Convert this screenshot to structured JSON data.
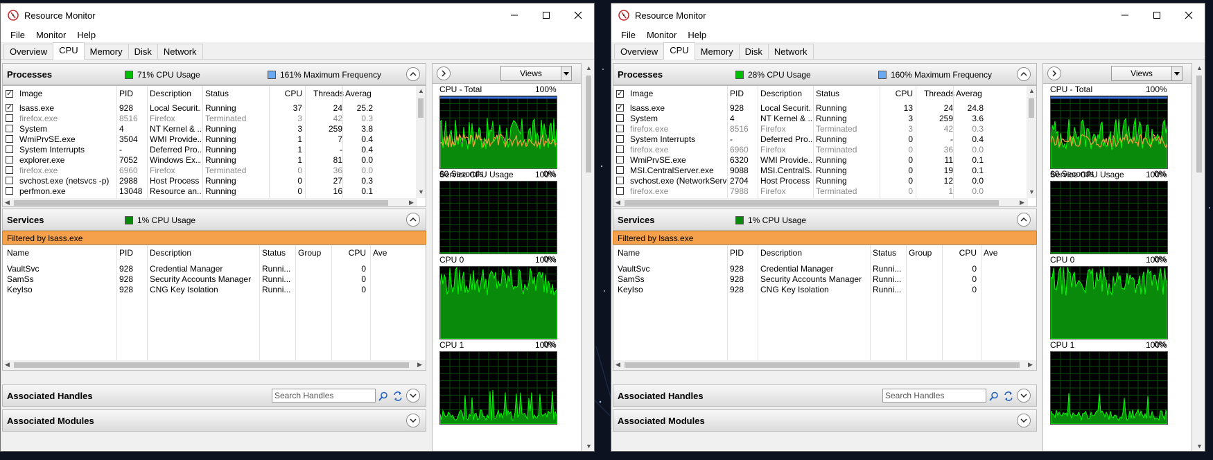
{
  "colors": {
    "cpu_usage": "#00c000",
    "max_freq": "#6aa9f1",
    "filter_bar": "#f5a04a",
    "graph_bg": "#000000",
    "graph_line": "#00ff00",
    "freq_line": "#f0a040"
  },
  "windows": [
    {
      "title": "Resource Monitor",
      "menu": [
        "File",
        "Monitor",
        "Help"
      ],
      "tabs": [
        "Overview",
        "CPU",
        "Memory",
        "Disk",
        "Network"
      ],
      "active_tab": "CPU",
      "processes": {
        "title": "Processes",
        "cpu_usage": "71% CPU Usage",
        "max_freq": "161% Maximum Frequency",
        "columns": [
          "Image",
          "PID",
          "Description",
          "Status",
          "CPU",
          "Threads",
          "Averag"
        ],
        "rows": [
          {
            "checked": true,
            "image": "lsass.exe",
            "pid": "928",
            "desc": "Local Securit...",
            "status": "Running",
            "cpu": "37",
            "threads": "24",
            "avg": "25.2",
            "terminated": false
          },
          {
            "checked": false,
            "image": "firefox.exe",
            "pid": "8516",
            "desc": "Firefox",
            "status": "Terminated",
            "cpu": "3",
            "threads": "42",
            "avg": "0.3",
            "terminated": true
          },
          {
            "checked": false,
            "image": "System",
            "pid": "4",
            "desc": "NT Kernel & ...",
            "status": "Running",
            "cpu": "3",
            "threads": "259",
            "avg": "3.8",
            "terminated": false
          },
          {
            "checked": false,
            "image": "WmiPrvSE.exe",
            "pid": "3504",
            "desc": "WMI Provide...",
            "status": "Running",
            "cpu": "1",
            "threads": "7",
            "avg": "0.4",
            "terminated": false
          },
          {
            "checked": false,
            "image": "System Interrupts",
            "pid": "-",
            "desc": "Deferred Pro...",
            "status": "Running",
            "cpu": "1",
            "threads": "-",
            "avg": "0.4",
            "terminated": false
          },
          {
            "checked": false,
            "image": "explorer.exe",
            "pid": "7052",
            "desc": "Windows Ex...",
            "status": "Running",
            "cpu": "1",
            "threads": "81",
            "avg": "0.0",
            "terminated": false
          },
          {
            "checked": false,
            "image": "firefox.exe",
            "pid": "6960",
            "desc": "Firefox",
            "status": "Terminated",
            "cpu": "0",
            "threads": "36",
            "avg": "0.0",
            "terminated": true
          },
          {
            "checked": false,
            "image": "svchost.exe (netsvcs -p)",
            "pid": "2988",
            "desc": "Host Process ...",
            "status": "Running",
            "cpu": "0",
            "threads": "27",
            "avg": "0.3",
            "terminated": false
          },
          {
            "checked": false,
            "image": "perfmon.exe",
            "pid": "13048",
            "desc": "Resource an...",
            "status": "Running",
            "cpu": "0",
            "threads": "16",
            "avg": "0.1",
            "terminated": false
          }
        ]
      },
      "services": {
        "title": "Services",
        "cpu_usage": "1% CPU Usage",
        "filter": "Filtered by lsass.exe",
        "columns": [
          "Name",
          "PID",
          "Description",
          "Status",
          "Group",
          "CPU",
          "Ave"
        ],
        "rows": [
          {
            "name": "VaultSvc",
            "pid": "928",
            "desc": "Credential Manager",
            "status": "Runni...",
            "group": "",
            "cpu": "0"
          },
          {
            "name": "SamSs",
            "pid": "928",
            "desc": "Security Accounts Manager",
            "status": "Runni...",
            "group": "",
            "cpu": "0"
          },
          {
            "name": "KeyIso",
            "pid": "928",
            "desc": "CNG Key Isolation",
            "status": "Runni...",
            "group": "",
            "cpu": "0"
          }
        ]
      },
      "handles": {
        "title": "Associated Handles",
        "search_placeholder": "Search Handles"
      },
      "modules": {
        "title": "Associated Modules"
      },
      "graphs": {
        "views": "Views",
        "items": [
          {
            "label": "CPU - Total",
            "max": "100%",
            "min": "0%",
            "footer": "60 Seconds"
          },
          {
            "label": "Service CPU Usage",
            "max": "100%",
            "min": "0%",
            "footer": ""
          },
          {
            "label": "CPU 0",
            "max": "100%",
            "min": "0%",
            "footer": ""
          },
          {
            "label": "CPU 1",
            "max": "100%",
            "min": "",
            "footer": ""
          }
        ]
      }
    },
    {
      "title": "Resource Monitor",
      "menu": [
        "File",
        "Monitor",
        "Help"
      ],
      "tabs": [
        "Overview",
        "CPU",
        "Memory",
        "Disk",
        "Network"
      ],
      "active_tab": "CPU",
      "processes": {
        "title": "Processes",
        "cpu_usage": "28% CPU Usage",
        "max_freq": "160% Maximum Frequency",
        "columns": [
          "Image",
          "PID",
          "Description",
          "Status",
          "CPU",
          "Threads",
          "Averag"
        ],
        "rows": [
          {
            "checked": true,
            "image": "lsass.exe",
            "pid": "928",
            "desc": "Local Securit...",
            "status": "Running",
            "cpu": "13",
            "threads": "24",
            "avg": "24.8",
            "terminated": false
          },
          {
            "checked": false,
            "image": "System",
            "pid": "4",
            "desc": "NT Kernel & ...",
            "status": "Running",
            "cpu": "3",
            "threads": "259",
            "avg": "3.6",
            "terminated": false
          },
          {
            "checked": false,
            "image": "firefox.exe",
            "pid": "8516",
            "desc": "Firefox",
            "status": "Terminated",
            "cpu": "3",
            "threads": "42",
            "avg": "0.3",
            "terminated": true
          },
          {
            "checked": false,
            "image": "System Interrupts",
            "pid": "-",
            "desc": "Deferred Pro...",
            "status": "Running",
            "cpu": "0",
            "threads": "-",
            "avg": "0.4",
            "terminated": false
          },
          {
            "checked": false,
            "image": "firefox.exe",
            "pid": "6960",
            "desc": "Firefox",
            "status": "Terminated",
            "cpu": "0",
            "threads": "36",
            "avg": "0.0",
            "terminated": true
          },
          {
            "checked": false,
            "image": "WmiPrvSE.exe",
            "pid": "6320",
            "desc": "WMI Provide...",
            "status": "Running",
            "cpu": "0",
            "threads": "11",
            "avg": "0.1",
            "terminated": false
          },
          {
            "checked": false,
            "image": "MSI.CentralServer.exe",
            "pid": "9088",
            "desc": "MSI.CentralS...",
            "status": "Running",
            "cpu": "0",
            "threads": "19",
            "avg": "0.1",
            "terminated": false
          },
          {
            "checked": false,
            "image": "svchost.exe (NetworkService...",
            "pid": "2704",
            "desc": "Host Process ...",
            "status": "Running",
            "cpu": "0",
            "threads": "12",
            "avg": "0.0",
            "terminated": false
          },
          {
            "checked": false,
            "image": "firefox.exe",
            "pid": "7988",
            "desc": "Firefox",
            "status": "Terminated",
            "cpu": "0",
            "threads": "1",
            "avg": "0.0",
            "terminated": true
          }
        ]
      },
      "services": {
        "title": "Services",
        "cpu_usage": "1% CPU Usage",
        "filter": "Filtered by lsass.exe",
        "columns": [
          "Name",
          "PID",
          "Description",
          "Status",
          "Group",
          "CPU",
          "Ave"
        ],
        "rows": [
          {
            "name": "VaultSvc",
            "pid": "928",
            "desc": "Credential Manager",
            "status": "Runni...",
            "group": "",
            "cpu": "0"
          },
          {
            "name": "SamSs",
            "pid": "928",
            "desc": "Security Accounts Manager",
            "status": "Runni...",
            "group": "",
            "cpu": "0"
          },
          {
            "name": "KeyIso",
            "pid": "928",
            "desc": "CNG Key Isolation",
            "status": "Runni...",
            "group": "",
            "cpu": "0"
          }
        ]
      },
      "handles": {
        "title": "Associated Handles",
        "search_placeholder": "Search Handles"
      },
      "modules": {
        "title": "Associated Modules"
      },
      "graphs": {
        "views": "Views",
        "items": [
          {
            "label": "CPU - Total",
            "max": "100%",
            "min": "0%",
            "footer": "60 Seconds"
          },
          {
            "label": "Service CPU Usage",
            "max": "100%",
            "min": "0%",
            "footer": ""
          },
          {
            "label": "CPU 0",
            "max": "100%",
            "min": "0%",
            "footer": ""
          },
          {
            "label": "CPU 1",
            "max": "100%",
            "min": "",
            "footer": ""
          }
        ]
      }
    }
  ]
}
